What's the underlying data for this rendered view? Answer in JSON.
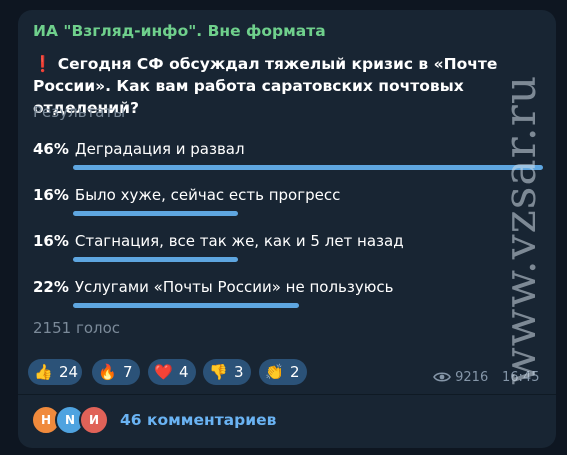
{
  "post": {
    "channel_name": "ИА \"Взгляд-инфо\". Вне формата",
    "question_mark": "❗",
    "question": "Сегодня СФ обсуждал тяжелый кризис в «Почте России». Как вам работа саратовских почтовых отделений?",
    "results_label": "Результаты",
    "options": [
      {
        "percent": "46%",
        "text": "Деградация и развал",
        "fraction": 1.0
      },
      {
        "percent": "16%",
        "text": "Было хуже, сейчас есть прогресс",
        "fraction": 0.35
      },
      {
        "percent": "16%",
        "text": "Стагнация, все так же, как и 5 лет назад",
        "fraction": 0.35
      },
      {
        "percent": "22%",
        "text": "Услугами «Почты России» не пользуюсь",
        "fraction": 0.48
      }
    ],
    "votes_label": "2151 голос",
    "views": "9216",
    "time": "16:45"
  },
  "reactions": [
    {
      "icon": "👍",
      "icon_name": "thumbs-up-icon",
      "count": "24"
    },
    {
      "icon": "🔥",
      "icon_name": "fire-icon",
      "count": "7"
    },
    {
      "icon": "❤️",
      "icon_name": "heart-icon",
      "count": "4"
    },
    {
      "icon": "👎",
      "icon_name": "thumbs-down-icon",
      "count": "3"
    },
    {
      "icon": "👏",
      "icon_name": "clapping-hands-icon",
      "count": "2"
    }
  ],
  "comments": {
    "avatars": [
      {
        "letter": "Н",
        "color": "#f08a3c"
      },
      {
        "letter": "N",
        "color": "#4fa3e0"
      },
      {
        "letter": "И",
        "color": "#e06258"
      }
    ],
    "label": "46 комментариев"
  },
  "watermark": "www.vzsar.ru",
  "colors": {
    "background": "#0e1621",
    "bubble": "#182533",
    "channel_name": "#6fd08c",
    "poll_bar": "#5ea6e0",
    "comments_link": "#6ab3f3",
    "reaction_pill": "#2b5278"
  }
}
